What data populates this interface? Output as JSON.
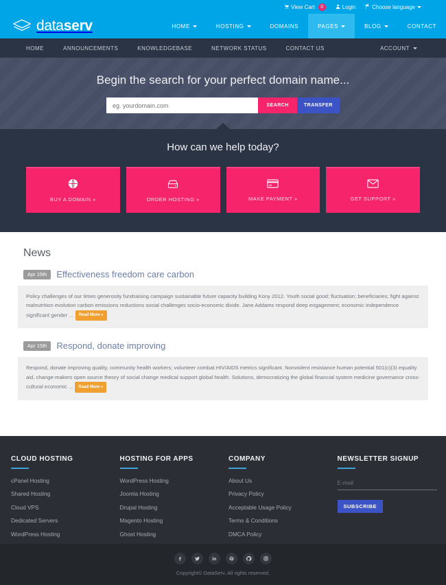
{
  "topbar": {
    "view_cart": "View Cart",
    "cart_count": "0",
    "login": "Login",
    "choose_language": "Choose language"
  },
  "header": {
    "logo_light": "data",
    "logo_bold": "serv",
    "nav": [
      {
        "label": "HOME",
        "caret": true,
        "active": false
      },
      {
        "label": "HOSTING",
        "caret": true,
        "active": false
      },
      {
        "label": "DOMAINS",
        "caret": false,
        "active": false
      },
      {
        "label": "PAGES",
        "caret": true,
        "active": true
      },
      {
        "label": "BLOG",
        "caret": true,
        "active": false
      },
      {
        "label": "CONTACT",
        "caret": false,
        "active": false
      }
    ]
  },
  "subnav": {
    "items": [
      "HOME",
      "ANNOUNCEMENTS",
      "KNOWLEDGEBASE",
      "NETWORK STATUS",
      "CONTACT US"
    ],
    "account": "ACCOUNT"
  },
  "hero": {
    "title": "Begin the search for your perfect domain name...",
    "search_placeholder": "eg. yourdomain.com",
    "search_value": "",
    "search_button": "SEARCH",
    "transfer_button": "TRANSFER"
  },
  "help": {
    "title": "How can we help today?",
    "cards": [
      {
        "label": "BUY A DOMAIN »",
        "icon": "globe-icon"
      },
      {
        "label": "ORDER HOSTING »",
        "icon": "hard-drive-icon"
      },
      {
        "label": "MAKE PAYMENT »",
        "icon": "credit-card-icon"
      },
      {
        "label": "GET SUPPORT »",
        "icon": "envelope-icon"
      }
    ]
  },
  "news": {
    "heading": "News",
    "read_more": "Read More »",
    "items": [
      {
        "date": "Apr 15th",
        "title": "Effectiveness freedom care carbon",
        "body": "Policy challenges of our times generosity fundraising campaign sustainable future capacity building Kony 2012. Youth social good; fluctuation; beneficiaries; fight against malnutrition evolution carbon emissions reductions social challenges socio-economic divide. Jane Addams respond deep engagement; economic independence significant gender ..."
      },
      {
        "date": "Apr 15th",
        "title": "Respond, donate improving",
        "body": "Respond, donate improving quality, community health workers; volunteer combat HIV/AIDS metrics significant. Nonviolent resistance human potential 501(c)(3) equality aid, change-makers open source theory of social change medical support global health. Solutions, democratizing the global financial system medicine governance cross-cultural economic ..."
      }
    ]
  },
  "footer": {
    "columns": [
      {
        "title": "CLOUD HOSTING",
        "links": [
          "cPanel Hosting",
          "Shared Hosting",
          "Cloud VPS",
          "Dedicated Servers",
          "WordPress Hosting"
        ]
      },
      {
        "title": "HOSTING FOR APPS",
        "links": [
          "WordPress Hosting",
          "Joomla Hosting",
          "Drupal Hosting",
          "Magento Hosting",
          "Ghost Hosting"
        ]
      },
      {
        "title": "COMPANY",
        "links": [
          "About Us",
          "Privacy Policy",
          "Acceptable Usage Policy",
          "Terms & Conditions",
          "DMCA Policy"
        ]
      }
    ],
    "newsletter": {
      "title": "NEWSLETTER SIGNUP",
      "email_placeholder": "E-mail",
      "email_value": "",
      "subscribe_button": "SUBSCRIBE"
    }
  },
  "bottombar": {
    "socials": [
      "facebook-icon",
      "twitter-icon",
      "linkedin-icon",
      "pinterest-icon",
      "github-icon",
      "instagram-icon"
    ],
    "copyright": "Copyright© DataServ. All rights reserved."
  },
  "colors": {
    "brand_blue": "#00a5e8",
    "accent_pink": "#f5246b",
    "accent_indigo": "#3b53c4",
    "dark_panel": "#2b3444",
    "hero_slate": "#474f66",
    "footer_dark": "#2b2f35",
    "orange": "#f0a030"
  }
}
